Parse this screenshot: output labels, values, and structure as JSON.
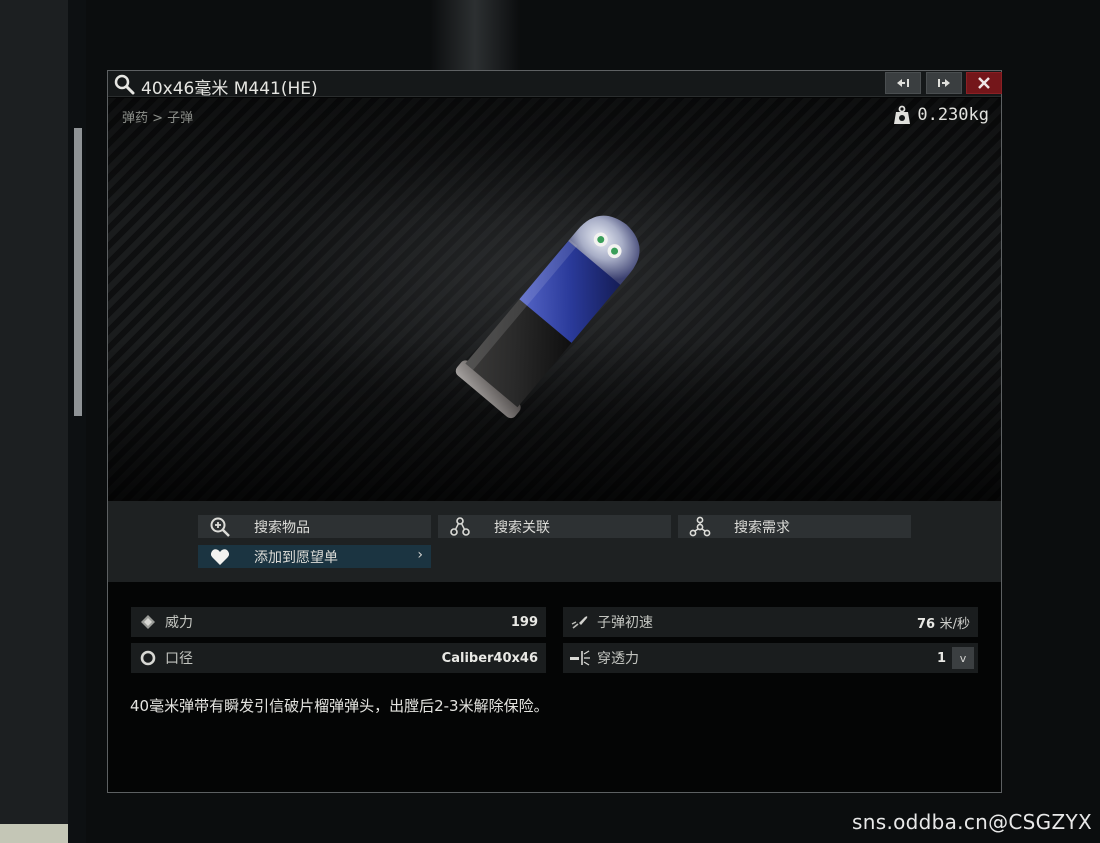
{
  "window": {
    "title": "40x46毫米 M441(HE)",
    "breadcrumb": "弹药 > 子弹",
    "weight": "0.230kg"
  },
  "actions": {
    "search_item": "搜索物品",
    "search_related": "搜索关联",
    "search_needed": "搜索需求",
    "add_wishlist": "添加到愿望单"
  },
  "stats": {
    "power_label": "威力",
    "power_value": "199",
    "velocity_label": "子弹初速",
    "velocity_value": "76",
    "velocity_unit": "米/秒",
    "caliber_label": "口径",
    "caliber_value": "Caliber40x46",
    "penetration_label": "穿透力",
    "penetration_value": "1"
  },
  "description": "40毫米弹带有瞬发引信破片榴弹弹头，出膛后2-3米解除保险。",
  "watermark": "sns.oddba.cn@CSGZYX",
  "colors": {
    "close_button": "#74161a",
    "wishlist_button": "#1b3441",
    "shell_band": "#2a3a9a"
  }
}
